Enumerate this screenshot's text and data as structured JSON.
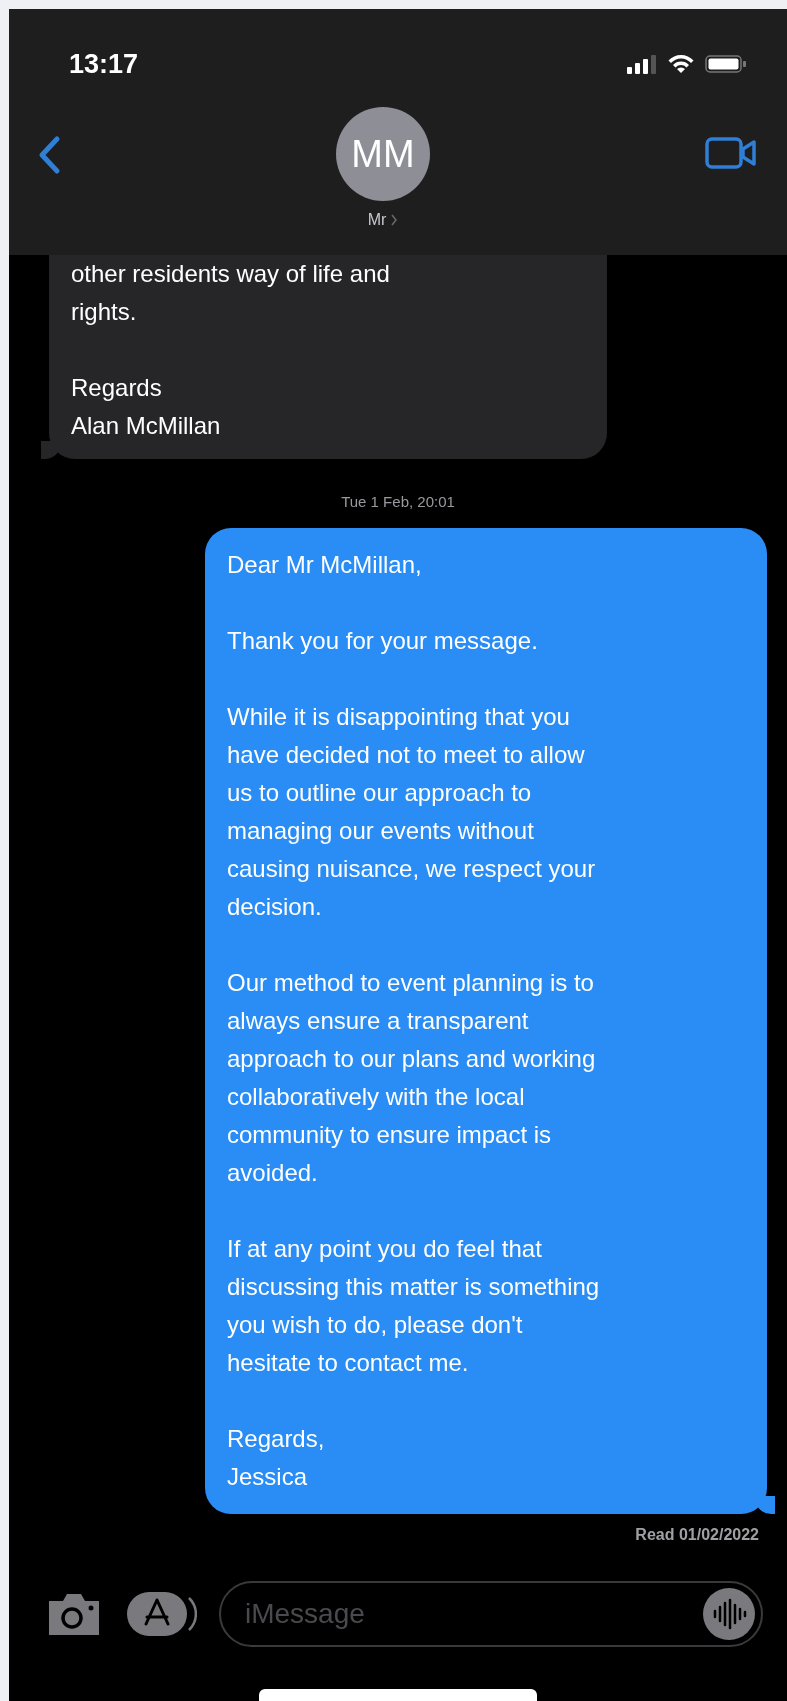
{
  "status_bar": {
    "time": "13:17"
  },
  "header": {
    "avatar_initials": "MM",
    "contact_name": "Mr"
  },
  "messages": [
    {
      "kind": "received",
      "paragraphs": [
        "other residents way of life and\nrights.",
        "Regards\nAlan McMillan"
      ]
    },
    {
      "kind": "timestamp",
      "text": "Tue 1 Feb, 20:01"
    },
    {
      "kind": "sent",
      "paragraphs": [
        "Dear Mr McMillan,",
        "Thank you for your message.",
        "While it is disappointing that you\nhave decided not to meet to allow\nus to outline our approach to\nmanaging our events without\ncausing nuisance, we respect your\ndecision.",
        "Our method to event planning is to\nalways ensure a transparent\napproach to our plans and working\ncollaboratively with the local\ncommunity to ensure impact is\navoided.",
        "If at any point you do feel that\ndiscussing this matter is something\nyou wish to do, please don't\nhesitate to contact me.",
        "Regards,\nJessica"
      ]
    }
  ],
  "read_receipt": "Read 01/02/2022",
  "composer": {
    "placeholder": "iMessage"
  }
}
